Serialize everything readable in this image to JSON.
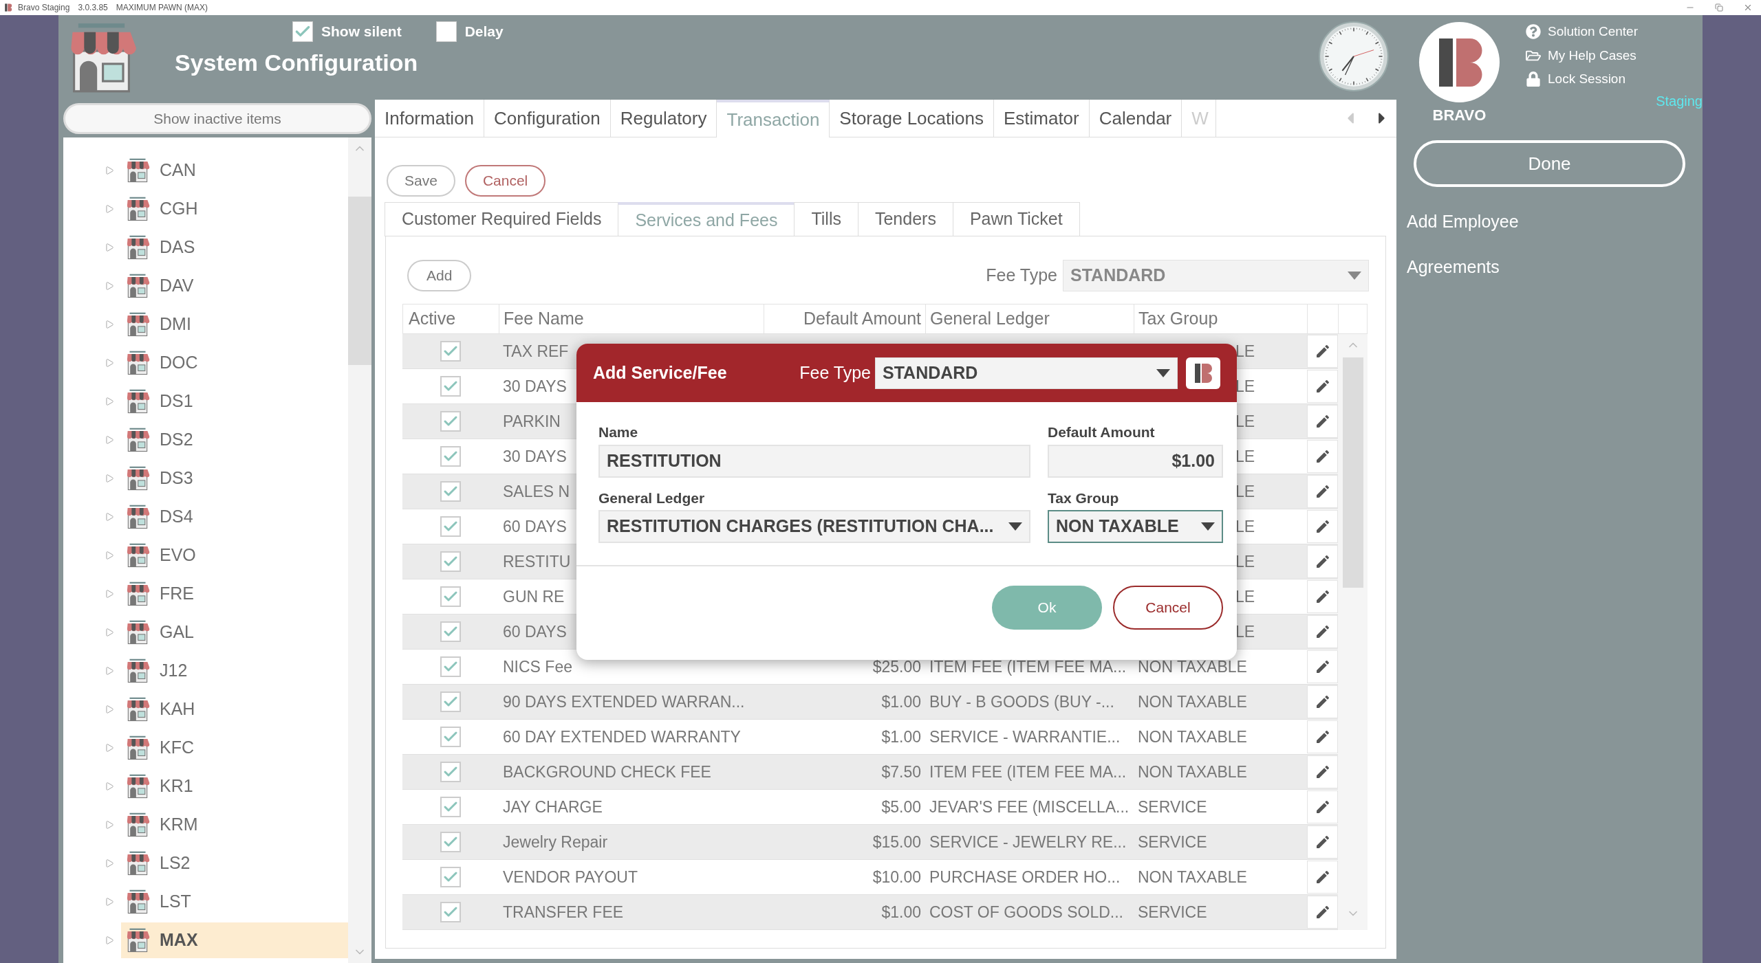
{
  "title_bar": {
    "app": "Bravo Staging",
    "version": "3.0.3.85",
    "store": "MAXIMUM PAWN (MAX)"
  },
  "header": {
    "title": "System Configuration",
    "options": [
      {
        "label": "Show silent",
        "checked": true
      },
      {
        "label": "Delay",
        "checked": false
      }
    ]
  },
  "user_menu": {
    "logo_label": "BRAVO",
    "environment": "Staging",
    "links": [
      {
        "label": "Solution Center",
        "kind": "help"
      },
      {
        "label": "My Help Cases",
        "kind": "folder"
      },
      {
        "label": "Lock Session",
        "kind": "lock"
      }
    ]
  },
  "sidebar": {
    "filter_button": "Show inactive items",
    "stores": [
      {
        "label": "CAN",
        "selected": false
      },
      {
        "label": "CGH",
        "selected": false
      },
      {
        "label": "DAS",
        "selected": false
      },
      {
        "label": "DAV",
        "selected": false
      },
      {
        "label": "DMI",
        "selected": false
      },
      {
        "label": "DOC",
        "selected": false
      },
      {
        "label": "DS1",
        "selected": false
      },
      {
        "label": "DS2",
        "selected": false
      },
      {
        "label": "DS3",
        "selected": false
      },
      {
        "label": "DS4",
        "selected": false
      },
      {
        "label": "EVO",
        "selected": false
      },
      {
        "label": "FRE",
        "selected": false
      },
      {
        "label": "GAL",
        "selected": false
      },
      {
        "label": "J12",
        "selected": false
      },
      {
        "label": "KAH",
        "selected": false
      },
      {
        "label": "KFC",
        "selected": false
      },
      {
        "label": "KR1",
        "selected": false
      },
      {
        "label": "KRM",
        "selected": false
      },
      {
        "label": "LS2",
        "selected": false
      },
      {
        "label": "LST",
        "selected": false
      },
      {
        "label": "MAX",
        "selected": true
      }
    ]
  },
  "tabs": [
    {
      "label": "Information",
      "selected": false
    },
    {
      "label": "Configuration",
      "selected": false
    },
    {
      "label": "Regulatory",
      "selected": false
    },
    {
      "label": "Transaction",
      "selected": true
    },
    {
      "label": "Storage Locations",
      "selected": false
    },
    {
      "label": "Estimator",
      "selected": false
    },
    {
      "label": "Calendar",
      "selected": false
    },
    {
      "label": "W",
      "selected": false
    }
  ],
  "toolbar": {
    "save": "Save",
    "cancel": "Cancel"
  },
  "subtabs": [
    {
      "label": "Customer Required Fields",
      "selected": false
    },
    {
      "label": "Services and Fees",
      "selected": true
    },
    {
      "label": "Tills",
      "selected": false
    },
    {
      "label": "Tenders",
      "selected": false
    },
    {
      "label": "Pawn Ticket",
      "selected": false
    }
  ],
  "fees": {
    "add": "Add",
    "fee_type_label": "Fee Type",
    "fee_type": "STANDARD",
    "columns": [
      "Active",
      "Fee Name",
      "Default Amount",
      "General Ledger",
      "Tax Group"
    ],
    "rows": [
      {
        "kind": "partial",
        "active": true,
        "name": "TAX REF",
        "tax_group": "LE"
      },
      {
        "kind": "partial",
        "active": true,
        "name": "30 DAYS",
        "tax_group": "LE"
      },
      {
        "kind": "partial",
        "active": true,
        "name": "PARKIN",
        "tax_group": "LE"
      },
      {
        "kind": "partial",
        "active": true,
        "name": "30 DAYS",
        "tax_group": "LE"
      },
      {
        "kind": "partial",
        "active": true,
        "name": "SALES N",
        "tax_group": "LE"
      },
      {
        "kind": "partial",
        "active": true,
        "name": "60 DAYS",
        "tax_group": "LE"
      },
      {
        "kind": "partial",
        "active": true,
        "name": "RESTITU",
        "tax_group": "LE"
      },
      {
        "kind": "partial",
        "active": true,
        "name": "GUN RE",
        "tax_group": "LE"
      },
      {
        "kind": "partial",
        "active": true,
        "name": "60 DAYS",
        "tax_group": "LE"
      },
      {
        "kind": "full",
        "active": true,
        "name": "NICS Fee",
        "amount": "$25.00",
        "ledger": "ITEM FEE (ITEM FEE MA...",
        "tax_group": "NON TAXABLE"
      },
      {
        "kind": "full",
        "active": true,
        "name": "90 DAYS EXTENDED WARRAN...",
        "amount": "$1.00",
        "ledger": "BUY - B GOODS (BUY -...",
        "tax_group": "NON TAXABLE"
      },
      {
        "kind": "full",
        "active": true,
        "name": "60 DAY EXTENDED WARRANTY",
        "amount": "$1.00",
        "ledger": "SERVICE - WARRANTIE...",
        "tax_group": "NON TAXABLE"
      },
      {
        "kind": "full",
        "active": true,
        "name": "BACKGROUND CHECK FEE",
        "amount": "$7.50",
        "ledger": "ITEM FEE (ITEM FEE MA...",
        "tax_group": "NON TAXABLE"
      },
      {
        "kind": "full",
        "active": true,
        "name": "JAY CHARGE",
        "amount": "$5.00",
        "ledger": "JEVAR'S FEE (MISCELLA...",
        "tax_group": "SERVICE"
      },
      {
        "kind": "full",
        "active": true,
        "name": "Jewelry Repair",
        "amount": "$15.00",
        "ledger": "SERVICE - JEWELRY RE...",
        "tax_group": "SERVICE"
      },
      {
        "kind": "full",
        "active": true,
        "name": "VENDOR PAYOUT",
        "amount": "$10.00",
        "ledger": "PURCHASE ORDER HO...",
        "tax_group": "NON TAXABLE"
      },
      {
        "kind": "full",
        "active": true,
        "name": "TRANSFER FEE",
        "amount": "$1.00",
        "ledger": "COST OF GOODS SOLD...",
        "tax_group": "SERVICE"
      }
    ]
  },
  "dialog": {
    "title": "Add Service/Fee",
    "fee_type_label": "Fee Type",
    "fee_type": "STANDARD",
    "fields": [
      {
        "label": "Name",
        "value": "RESTITUTION",
        "kind": "text",
        "focused": false
      },
      {
        "label": "Default Amount",
        "value": "$1.00",
        "kind": "amount",
        "focused": false
      },
      {
        "label": "General Ledger",
        "value": "RESTITUTION CHARGES (RESTITUTION CHA...",
        "kind": "select",
        "focused": false
      },
      {
        "label": "Tax Group",
        "value": "NON TAXABLE",
        "kind": "select",
        "focused": true
      }
    ],
    "ok": "Ok",
    "cancel": "Cancel"
  },
  "right_panel": {
    "done": "Done",
    "actions": [
      "Add Employee",
      "Agreements"
    ]
  }
}
